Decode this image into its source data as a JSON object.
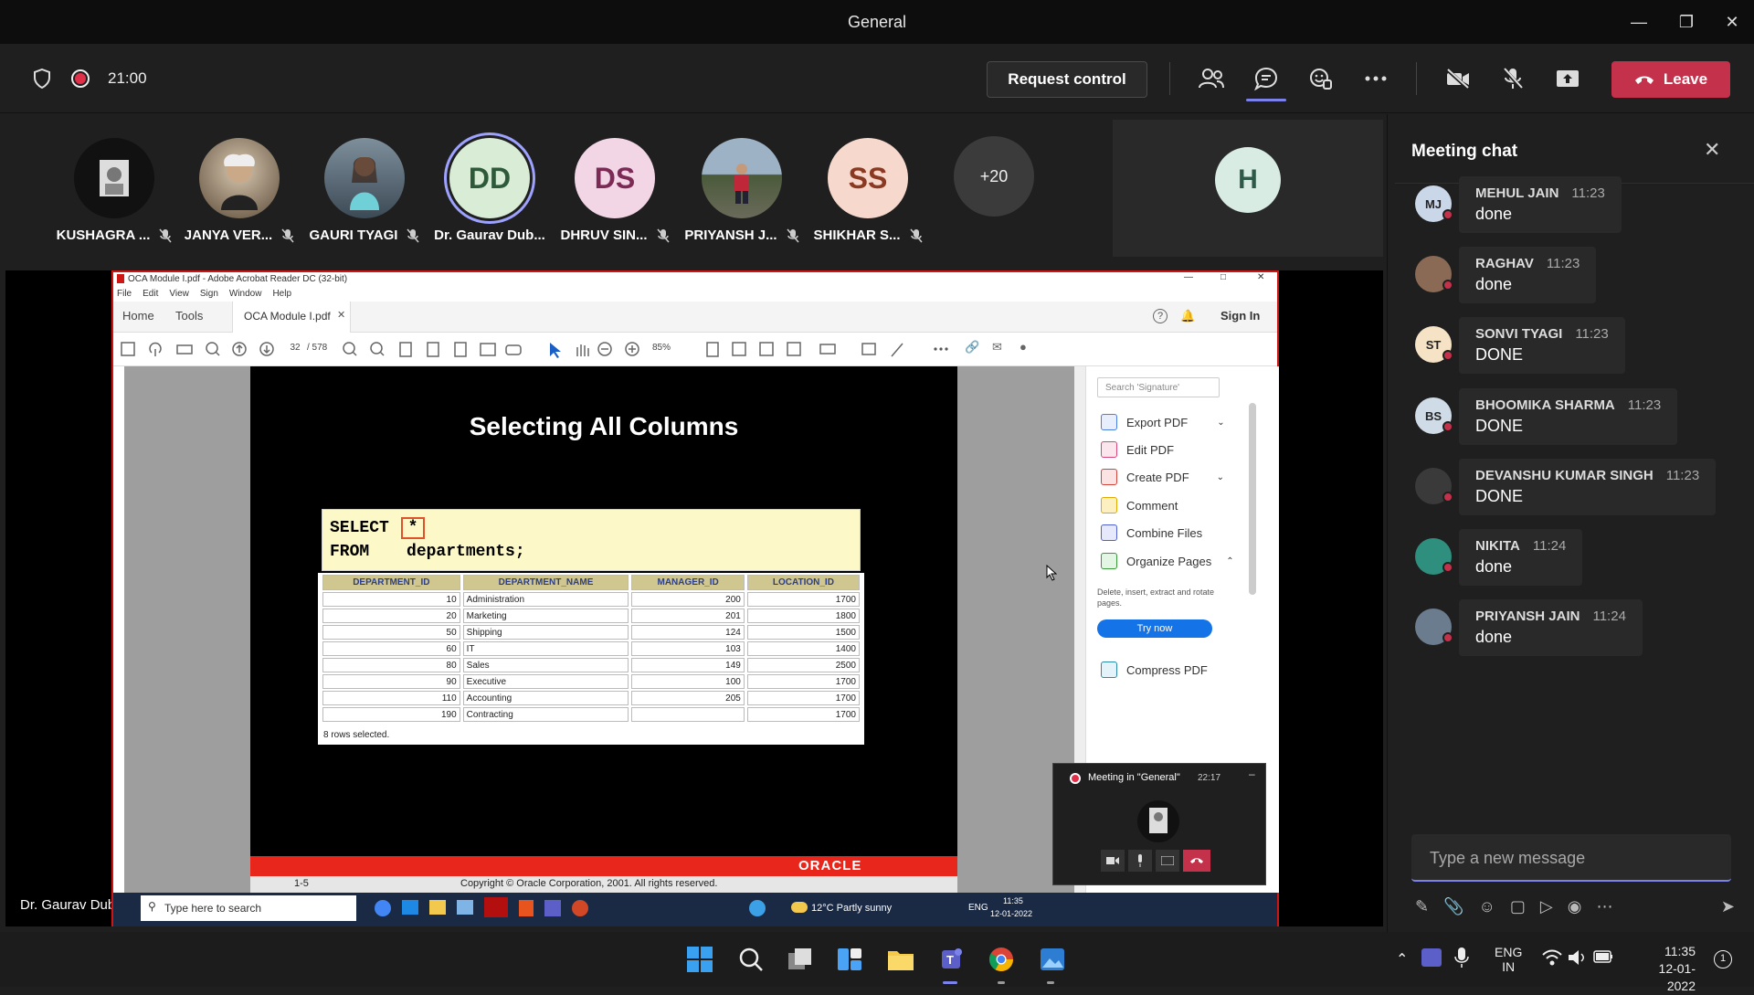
{
  "window": {
    "title": "General"
  },
  "toolbar": {
    "timer": "21:00",
    "request_control": "Request control",
    "leave": "Leave"
  },
  "participants": [
    {
      "name": "KUSHAGRA ...",
      "initials": "",
      "color": "#111111"
    },
    {
      "name": "JANYA VER...",
      "initials": "",
      "color": "#8a7a5a"
    },
    {
      "name": "GAURI TYAGI",
      "initials": "",
      "color": "#6a7a8a"
    },
    {
      "name": "Dr. Gaurav Dub...",
      "initials": "DD",
      "color": "#d9ecd6"
    },
    {
      "name": "DHRUV SIN...",
      "initials": "DS",
      "color": "#f2d6e6"
    },
    {
      "name": "PRIYANSH J...",
      "initials": "",
      "color": "#6b7c8f"
    },
    {
      "name": "SHIKHAR S...",
      "initials": "SS",
      "color": "#f6d8cc"
    }
  ],
  "more_participants": "+20",
  "extra_avatar": "H",
  "presenter_label": "Dr. Gaurav Dubey",
  "acrobat": {
    "title": "OCA Module I.pdf - Adobe Acrobat Reader DC (32-bit)",
    "menu": [
      "File",
      "Edit",
      "View",
      "Sign",
      "Window",
      "Help"
    ],
    "tabs": {
      "home": "Home",
      "tools": "Tools",
      "doc": "OCA Module I.pdf"
    },
    "sign_in": "Sign In",
    "page_current": "32",
    "page_total": "/ 578",
    "zoom": "85%",
    "search_placeholder": "Search 'Signature'",
    "tools_pane": [
      "Export PDF",
      "Edit PDF",
      "Create PDF",
      "Comment",
      "Combine Files",
      "Organize Pages"
    ],
    "organize_desc": "Delete, insert, extract and rotate pages.",
    "try_now": "Try now",
    "compress": "Compress PDF"
  },
  "slide": {
    "title": "Selecting All Columns",
    "sql_line1_kw": "SELECT",
    "sql_star": "*",
    "sql_line2_kw": "FROM",
    "sql_line2_rest": "departments;",
    "columns": [
      "DEPARTMENT_ID",
      "DEPARTMENT_NAME",
      "MANAGER_ID",
      "LOCATION_ID"
    ],
    "rows": [
      [
        "10",
        "Administration",
        "200",
        "1700"
      ],
      [
        "20",
        "Marketing",
        "201",
        "1800"
      ],
      [
        "50",
        "Shipping",
        "124",
        "1500"
      ],
      [
        "60",
        "IT",
        "103",
        "1400"
      ],
      [
        "80",
        "Sales",
        "149",
        "2500"
      ],
      [
        "90",
        "Executive",
        "100",
        "1700"
      ],
      [
        "110",
        "Accounting",
        "205",
        "1700"
      ],
      [
        "190",
        "Contracting",
        "",
        "1700"
      ]
    ],
    "rows_selected": "8 rows selected.",
    "oracle": "ORACLE",
    "page_no": "1-5",
    "copyright": "Copyright © Oracle Corporation, 2001. All rights reserved."
  },
  "inner_taskbar": {
    "search": "Type here to search",
    "weather": "12°C  Partly sunny",
    "lang": "ENG",
    "time": "11:35",
    "date": "12-01-2022"
  },
  "selfview": {
    "title": "Meeting in \"General\"",
    "time": "22:17"
  },
  "chat": {
    "title": "Meeting chat",
    "messages": [
      {
        "initials": "MJ",
        "name": "MEHUL JAIN",
        "time": "11:23",
        "text": "done",
        "color": "#c9d7e8"
      },
      {
        "initials": "",
        "name": "RAGHAV",
        "time": "11:23",
        "text": "done",
        "color": "#8b6a55"
      },
      {
        "initials": "ST",
        "name": "SONVI TYAGI",
        "time": "11:23",
        "text": "DONE",
        "color": "#f6e3c6"
      },
      {
        "initials": "BS",
        "name": "BHOOMIKA SHARMA",
        "time": "11:23",
        "text": "DONE",
        "color": "#cfdbe6"
      },
      {
        "initials": "",
        "name": "DEVANSHU KUMAR SINGH",
        "time": "11:23",
        "text": "DONE",
        "color": "#3a3a3a"
      },
      {
        "initials": "",
        "name": "NIKITA",
        "time": "11:24",
        "text": "done",
        "color": "#2f8f7f"
      },
      {
        "initials": "",
        "name": "PRIYANSH JAIN",
        "time": "11:24",
        "text": "done",
        "color": "#6b7c8f"
      }
    ],
    "input_placeholder": "Type a new message"
  },
  "taskbar": {
    "lang_top": "ENG",
    "lang_bottom": "IN",
    "time": "11:35",
    "date": "12-01-2022",
    "notif_count": "1"
  }
}
